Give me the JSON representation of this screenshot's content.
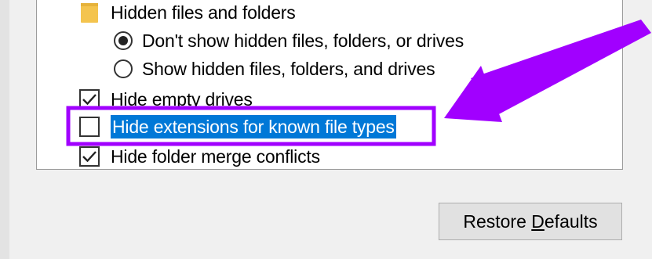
{
  "settings_list": {
    "group_label": "Hidden files and folders",
    "radio_dont_show": {
      "label": "Don't show hidden files, folders, or drives",
      "selected": true
    },
    "radio_show": {
      "label": "Show hidden files, folders, and drives",
      "selected": false
    },
    "hide_empty_drives": {
      "label": "Hide empty drives",
      "checked": true
    },
    "hide_extensions": {
      "label": "Hide extensions for known file types",
      "checked": false
    },
    "hide_merge_conflicts": {
      "label": "Hide folder merge conflicts",
      "checked": true
    }
  },
  "buttons": {
    "restore_prefix": "Restore ",
    "restore_mnemonic": "D",
    "restore_suffix": "efaults"
  },
  "icons": {
    "folder": "folder-icon",
    "checkmark": "checkmark-icon",
    "scroll_down": "chevron-down-icon",
    "annotation_arrow": "arrow-icon"
  },
  "colors": {
    "selection": "#0078d7",
    "annotation": "#a100ff",
    "folder": "#f4c44e"
  }
}
